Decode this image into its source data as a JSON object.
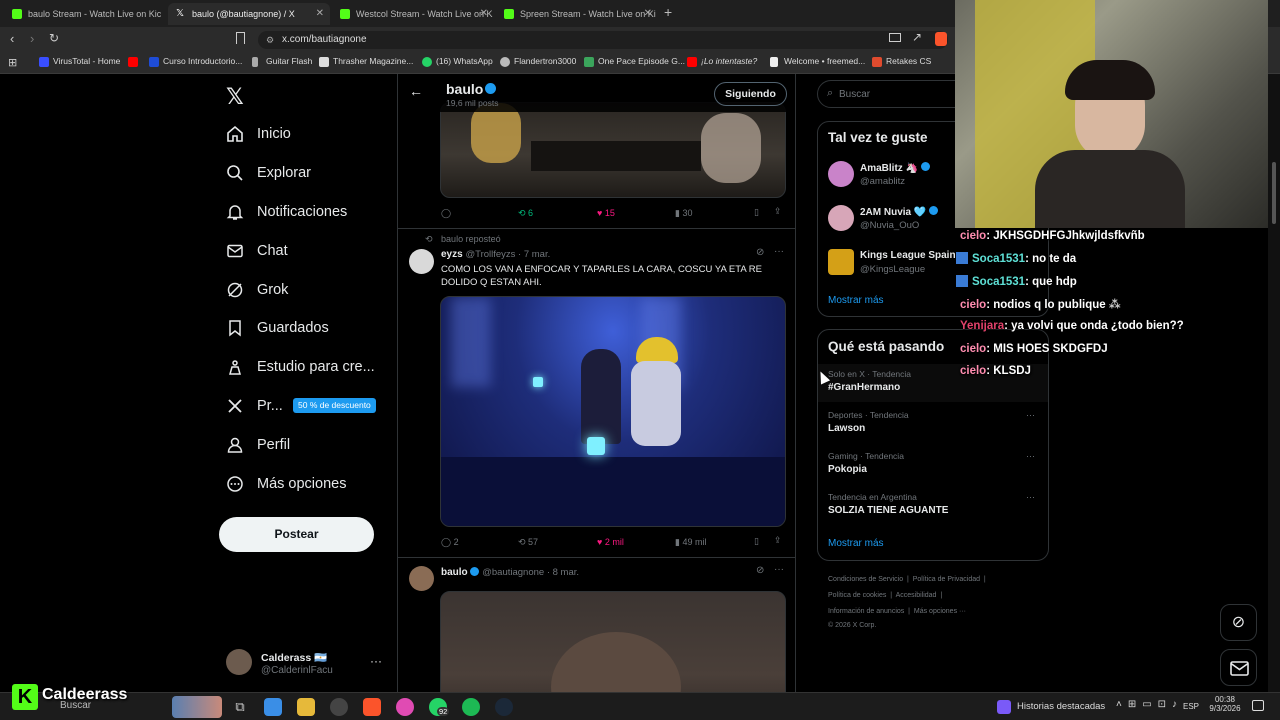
{
  "tabs": [
    {
      "title": "baulo Stream - Watch Live on Kic",
      "color": "#53fc18"
    },
    {
      "title": "baulo (@bautiagnone) / X",
      "color": "#ffffff"
    },
    {
      "title": "Westcol Stream - Watch Live on K",
      "color": "#53fc18"
    },
    {
      "title": "Spreen Stream - Watch Live on Ki",
      "color": "#53fc18"
    }
  ],
  "url": "x.com/bautiagnone",
  "bookmarks": [
    {
      "label": "VirusTotal - Home",
      "color": "#394eff"
    },
    {
      "label": "",
      "color": "#ff0000"
    },
    {
      "label": "Curso Introductorio...",
      "color": "#1e4cd6"
    },
    {
      "label": "Guitar Flash",
      "color": "#aaaaaa"
    },
    {
      "label": "Thrasher Magazine...",
      "color": "#dddddd"
    },
    {
      "label": "(16) WhatsApp",
      "color": "#25d366"
    },
    {
      "label": "Flandertron3000",
      "color": "#bbbbbb"
    },
    {
      "label": "One Pace Episode G...",
      "color": "#3ba55c"
    },
    {
      "label": "¡Lo intentaste?",
      "color": "#ff0000"
    },
    {
      "label": "Welcome • freemed...",
      "color": "#eeeeee"
    },
    {
      "label": "Retakes CS",
      "color": "#e04b2e"
    }
  ],
  "nav": {
    "items": [
      "Inicio",
      "Explorar",
      "Notificaciones",
      "Chat",
      "Grok",
      "Guardados",
      "Estudio para cre...",
      "Pr...",
      "Perfil",
      "Más opciones"
    ],
    "premium_badge": "50 % de descuento",
    "post_button": "Postear"
  },
  "account": {
    "name": "Calderass 🇦🇷",
    "handle": "@CalderinlFacu"
  },
  "profile_header": {
    "name": "baulo",
    "posts": "19,6 mil posts",
    "follow": "Siguiendo"
  },
  "post1_stats": {
    "replies": "",
    "reposts": "6",
    "likes": "15",
    "views": "30"
  },
  "post2": {
    "repost_label": "baulo reposteó",
    "name": "eyzs",
    "handle": "@Trollfeyzs · 7 mar.",
    "text_line1": "COMO LOS VAN A ENFOCAR Y TAPARLES LA CARA, COSCU YA ETA RE",
    "text_line2": "DOLIDO Q ESTAN AHI.",
    "replies": "2",
    "reposts": "57",
    "likes": "2 mil",
    "views": "49 mil"
  },
  "post3": {
    "name": "baulo",
    "handle": "@bautiagnone · 8 mar."
  },
  "search": {
    "placeholder": "Buscar"
  },
  "suggestions": {
    "title": "Tal vez te guste",
    "users": [
      {
        "name": "AmaBlitz 🦄",
        "handle": "@amablitz",
        "color": "#c983c9"
      },
      {
        "name": "2AM Nuvia 🩵",
        "handle": "@Nuvia_OuO",
        "color": "#d7a6b8"
      },
      {
        "name": "Kings League Spain",
        "handle": "@KingsLeague",
        "color": "#d4a017"
      }
    ],
    "more": "Mostrar más"
  },
  "trends": {
    "title": "Qué está pasando",
    "items": [
      {
        "cat": "Solo en X · Tendencia",
        "name": "#GranHermano"
      },
      {
        "cat": "Deportes · Tendencia",
        "name": "Lawson"
      },
      {
        "cat": "Gaming · Tendencia",
        "name": "Pokopia"
      },
      {
        "cat": "Tendencia en Argentina",
        "name": "SOLZIA TIENE AGUANTE"
      }
    ],
    "more": "Mostrar más"
  },
  "footer": {
    "l1a": "Condiciones de Servicio",
    "l1b": "Política de Privacidad",
    "l2a": "Política de cookies",
    "l2b": "Accesibilidad",
    "l3a": "Información de anuncios",
    "l3b": "Más opciones ···",
    "copy": "© 2026 X Corp."
  },
  "chat": [
    {
      "user": "cielo",
      "msg": ": JKHSGDHFGJhkwjldsfkvñb",
      "color": "#ff8db0"
    },
    {
      "user": "Soca1531",
      "msg": ": no te da",
      "color": "#5ee0d6"
    },
    {
      "user": "Soca1531",
      "msg": ": que hdp",
      "color": "#5ee0d6"
    },
    {
      "user": "cielo",
      "msg": ": nodios q lo publique",
      "color": "#ff8db0"
    },
    {
      "user": "Yenijara",
      "msg": ": ya volvi que onda ¿todo bien??",
      "color": "#e2426b"
    },
    {
      "user": "cielo",
      "msg": ": MIS HOES SKDGFDJ",
      "color": "#ff8db0"
    },
    {
      "user": "cielo",
      "msg": ": KLSDJ",
      "color": "#ff8db0"
    }
  ],
  "streamer": {
    "name": "Caldeerass"
  },
  "taskbar": {
    "search": "Buscar",
    "whatsapp_badge": "92",
    "news": "Historias destacadas",
    "lang": "ESP",
    "time": "00:38",
    "date": "9/3/2026"
  }
}
